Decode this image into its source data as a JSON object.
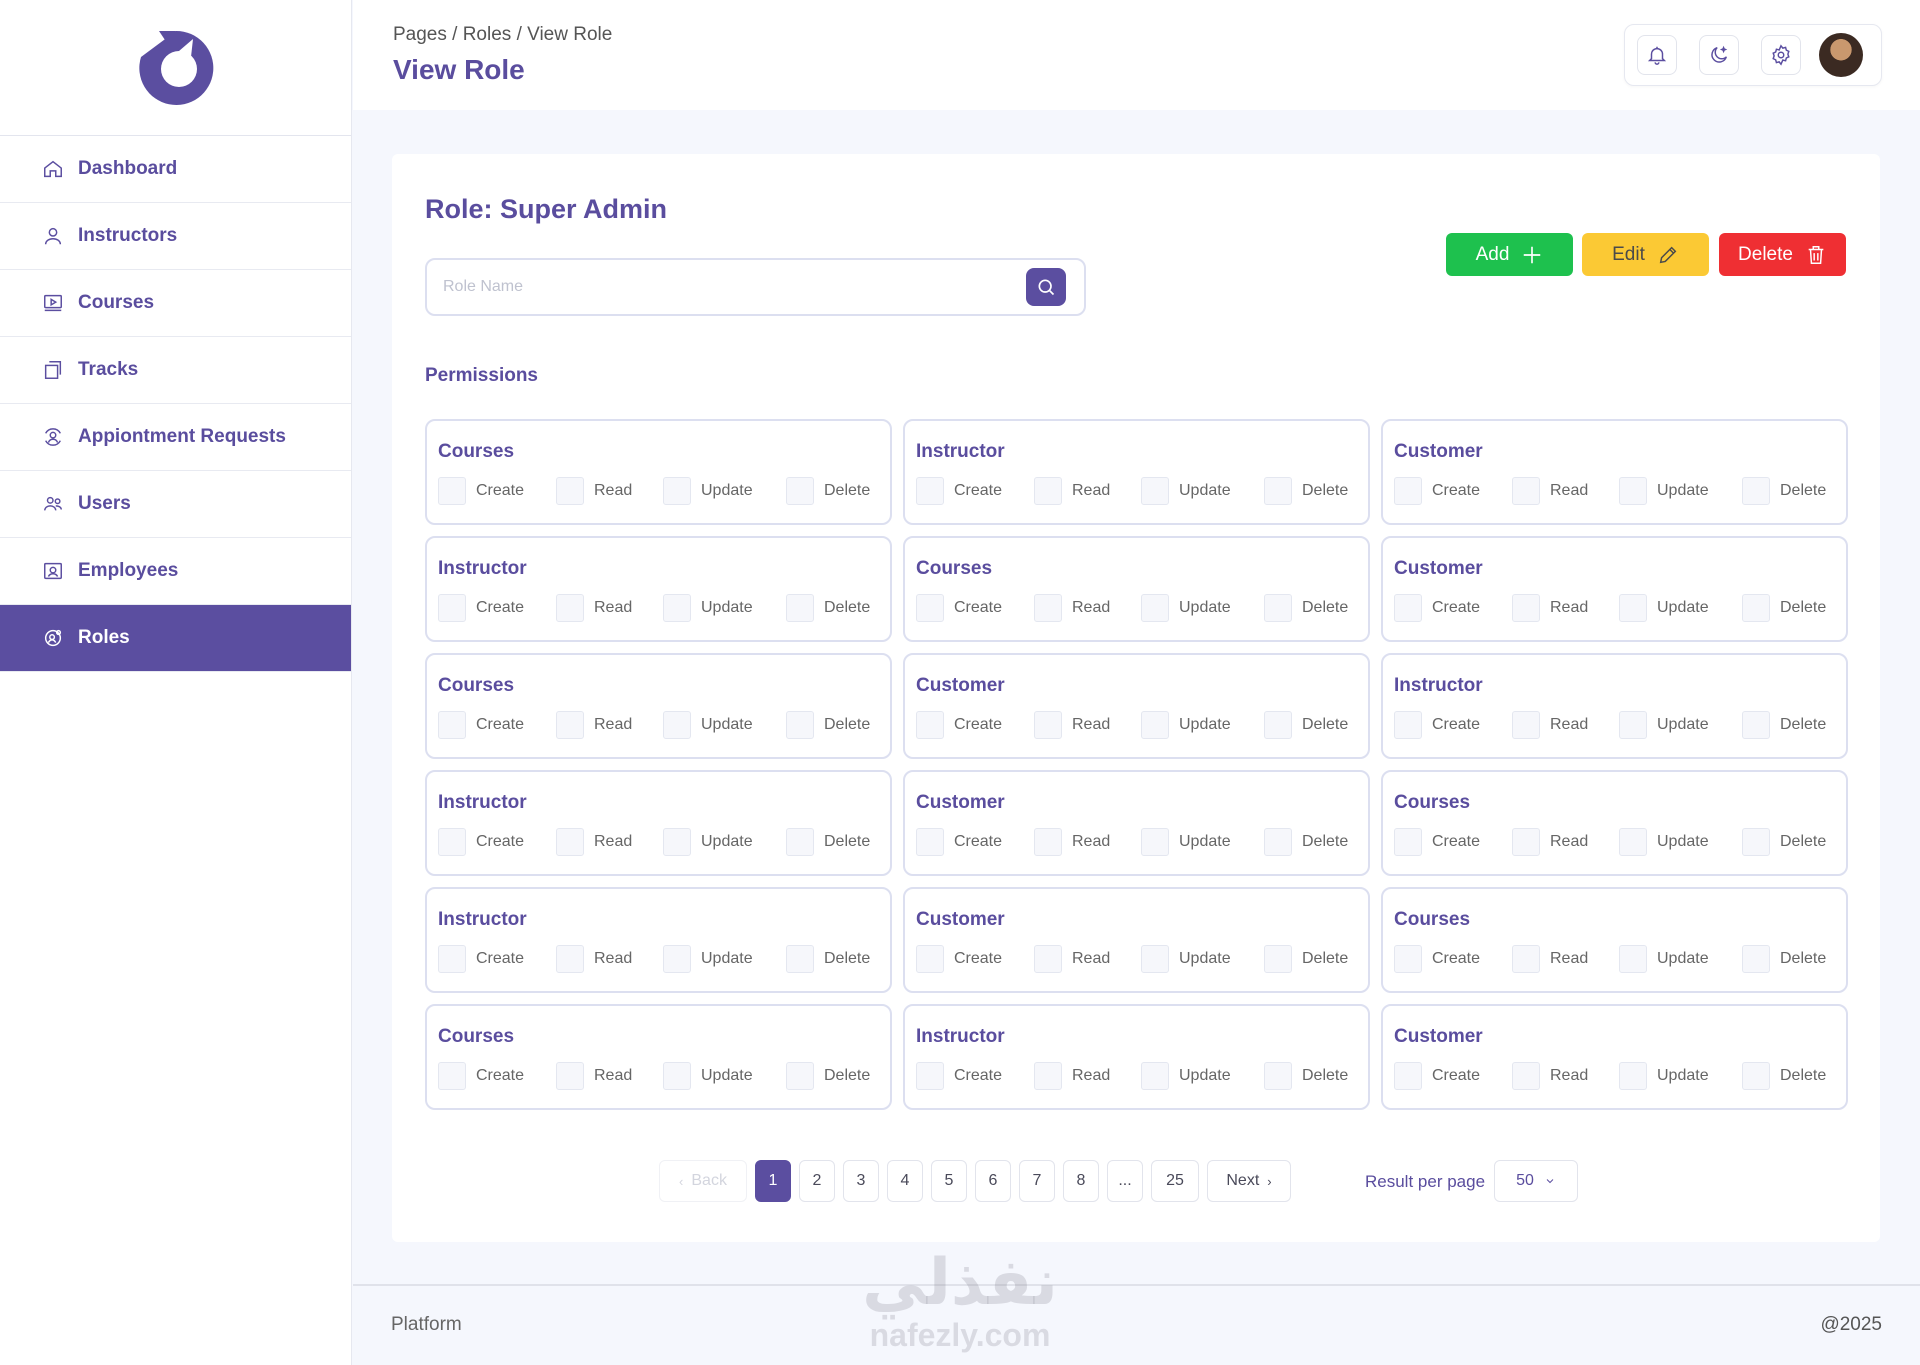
{
  "sidebar": {
    "items": [
      {
        "label": "Dashboard",
        "icon": "home-icon"
      },
      {
        "label": "Instructors",
        "icon": "user-icon"
      },
      {
        "label": "Courses",
        "icon": "video-icon"
      },
      {
        "label": "Tracks",
        "icon": "layers-icon"
      },
      {
        "label": "Appiontment Requests",
        "icon": "user-search-icon"
      },
      {
        "label": "Users",
        "icon": "users-icon"
      },
      {
        "label": "Employees",
        "icon": "id-card-icon"
      },
      {
        "label": "Roles",
        "icon": "user-gear-icon",
        "active": true
      }
    ]
  },
  "header": {
    "breadcrumb": "Pages / Roles / View Role",
    "title": "View Role"
  },
  "main": {
    "role_title": "Role: Super Admin",
    "search_placeholder": "Role Name",
    "buttons": {
      "add": "Add",
      "edit": "Edit",
      "delete": "Delete"
    },
    "permissions_label": "Permissions",
    "permission_labels": [
      "Create",
      "Read",
      "Update",
      "Delete"
    ],
    "cards": [
      {
        "title": "Courses"
      },
      {
        "title": "Instructor"
      },
      {
        "title": "Customer"
      },
      {
        "title": "Instructor"
      },
      {
        "title": "Courses"
      },
      {
        "title": "Customer"
      },
      {
        "title": "Courses"
      },
      {
        "title": "Customer"
      },
      {
        "title": "Instructor"
      },
      {
        "title": "Instructor"
      },
      {
        "title": "Customer"
      },
      {
        "title": "Courses"
      },
      {
        "title": "Instructor"
      },
      {
        "title": "Customer"
      },
      {
        "title": "Courses"
      },
      {
        "title": "Courses"
      },
      {
        "title": "Instructor"
      },
      {
        "title": "Customer"
      }
    ]
  },
  "pagination": {
    "back": "Back",
    "pages": [
      "1",
      "2",
      "3",
      "4",
      "5",
      "6",
      "7",
      "8",
      "...",
      "25"
    ],
    "current": "1",
    "next": "Next",
    "results_label": "Result per page",
    "results_value": "50"
  },
  "footer": {
    "left": "Platform",
    "right": "@2025"
  },
  "watermark": {
    "arabic": "نفذلي",
    "latin": "nafezly.com"
  },
  "colors": {
    "primary": "#5b4ea0",
    "add": "#1ec14e",
    "edit": "#fbc934",
    "delete": "#ef2f33"
  }
}
